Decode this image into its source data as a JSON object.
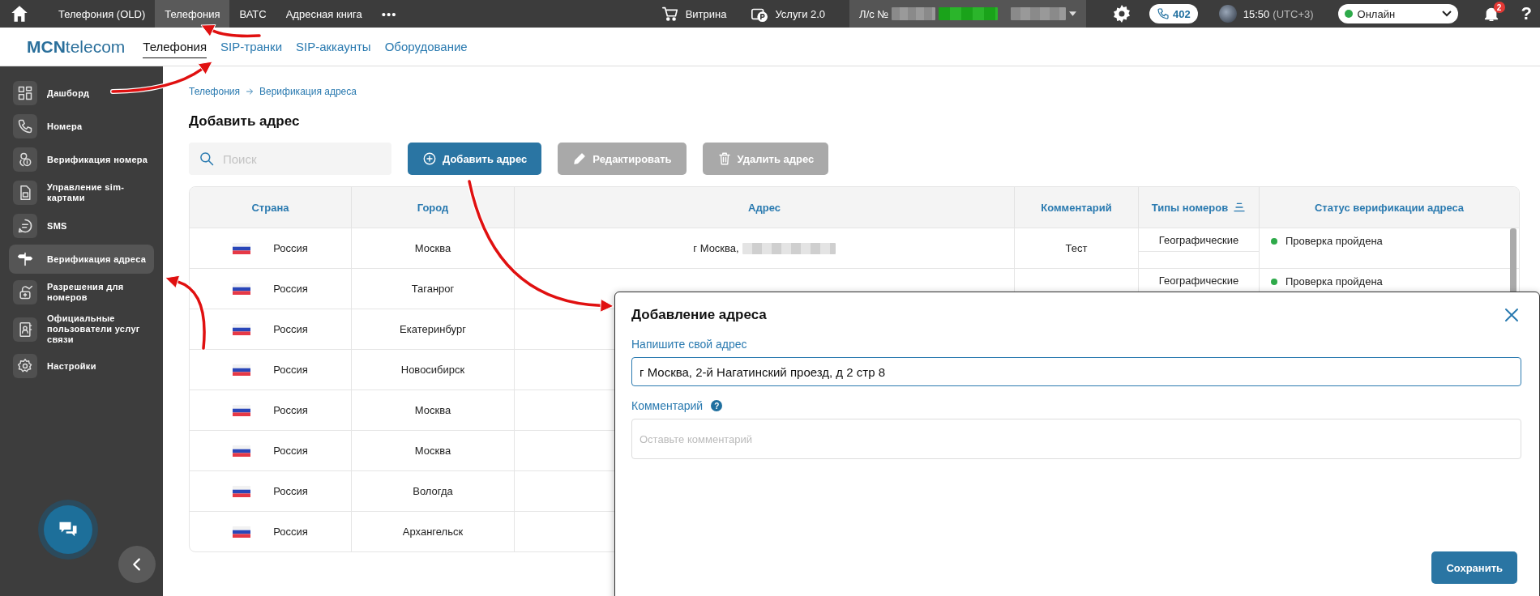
{
  "top_bar": {
    "menu": [
      {
        "label": "Телефония (OLD)",
        "selected": false
      },
      {
        "label": "Телефония",
        "selected": true
      },
      {
        "label": "ВАТС",
        "selected": false
      },
      {
        "label": "Адресная книга",
        "selected": false
      }
    ],
    "more": "•••",
    "shop": "Витрина",
    "services": "Услуги 2.0",
    "account": "Л/с №",
    "calls": "402",
    "time": "15:50",
    "timezone": "(UTC+3)",
    "status": "Онлайн",
    "notifications": "2",
    "help": "?"
  },
  "logo": {
    "bold": "MCN",
    "rest": "telecom"
  },
  "tabs": [
    {
      "label": "Телефония",
      "selected": true
    },
    {
      "label": "SIP-транки",
      "selected": false
    },
    {
      "label": "SIP-аккаунты",
      "selected": false
    },
    {
      "label": "Оборудование",
      "selected": false
    }
  ],
  "sidebar": {
    "items": [
      {
        "label": "Дашборд",
        "selected": false
      },
      {
        "label": "Номера",
        "selected": false
      },
      {
        "label": "Верификация номера",
        "selected": false
      },
      {
        "label": "Управление sim-картами",
        "selected": false
      },
      {
        "label": "SMS",
        "selected": false
      },
      {
        "label": "Верификация адреса",
        "selected": true
      },
      {
        "label": "Разрешения для номеров",
        "selected": false
      },
      {
        "label": "Официальные пользователи услуг связи",
        "selected": false
      },
      {
        "label": "Настройки",
        "selected": false
      }
    ]
  },
  "breadcrumb": [
    "Телефония",
    "Верификация адреса"
  ],
  "page_title": "Добавить адрес",
  "search": {
    "placeholder": "Поиск"
  },
  "actions": [
    {
      "label": "Добавить адрес",
      "disabled": false
    },
    {
      "label": "Редактировать",
      "disabled": true
    },
    {
      "label": "Удалить адрес",
      "disabled": true
    }
  ],
  "table": {
    "columns": [
      "Страна",
      "Город",
      "Адрес",
      "Комментарий",
      "Типы номеров",
      "Статус верификации адреса"
    ],
    "rows": [
      {
        "country": "Россия",
        "city": "Москва",
        "address": "г Москва,",
        "comment": "Тест",
        "number_type": "Географические",
        "status": "Проверка пройдена"
      },
      {
        "country": "Россия",
        "city": "Таганрог",
        "number_type": "Географические",
        "status": "Проверка пройдена"
      },
      {
        "country": "Россия",
        "city": "Екатеринбург"
      },
      {
        "country": "Россия",
        "city": "Новосибирск"
      },
      {
        "country": "Россия",
        "city": "Москва"
      },
      {
        "country": "Россия",
        "city": "Москва"
      },
      {
        "country": "Россия",
        "city": "Вологда"
      },
      {
        "country": "Россия",
        "city": "Архангельск"
      }
    ]
  },
  "modal": {
    "title": "Добавление адреса",
    "address_label": "Напишите свой адрес",
    "address_value": "г Москва, 2-й Нагатинский проезд, д 2 стр 8",
    "comment_label": "Комментарий",
    "comment_help": "?",
    "comment_placeholder": "Оставьте комментарий",
    "save": "Сохранить"
  }
}
